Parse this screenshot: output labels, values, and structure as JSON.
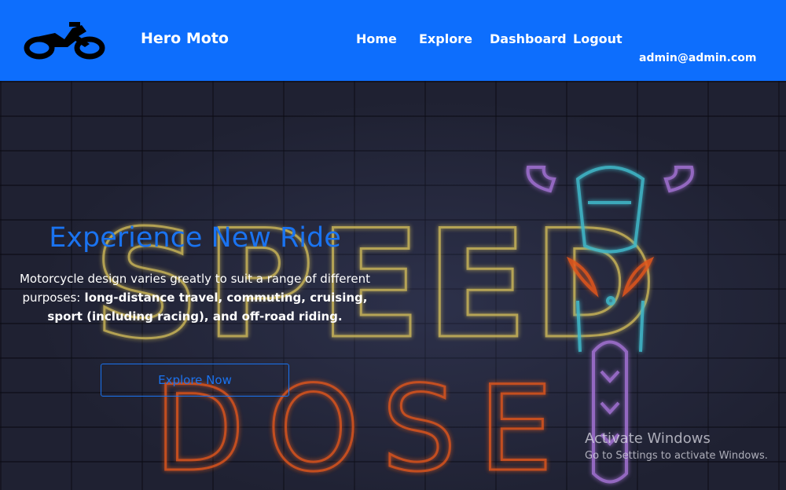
{
  "navbar": {
    "brand": "Hero Moto",
    "logo_icon": "motorcycle-icon",
    "links": [
      "Home",
      "Explore",
      "Dashboard",
      "Logout"
    ],
    "user_email": "admin@admin.com",
    "colors": {
      "background": "#0d6efd",
      "text": "#ffffff"
    }
  },
  "hero": {
    "title": "Experience New Ride",
    "description_plain": "Motorcycle design varies greatly to suit a range of different purposes:",
    "description_bold": "long-distance travel, commuting, cruising, sport (including racing), and off-road riding.",
    "button_label": "Explore Now",
    "neon_text": {
      "top": "SPEED",
      "bottom": "DOSE"
    },
    "colors": {
      "accent": "#1a73f0",
      "neon_yellow": "#d8c15a",
      "neon_orange": "#e0561e",
      "neon_cyan": "#3fb8c9",
      "neon_purple": "#a070d0"
    }
  },
  "watermark": {
    "title": "Activate Windows",
    "subtitle": "Go to Settings to activate Windows."
  }
}
